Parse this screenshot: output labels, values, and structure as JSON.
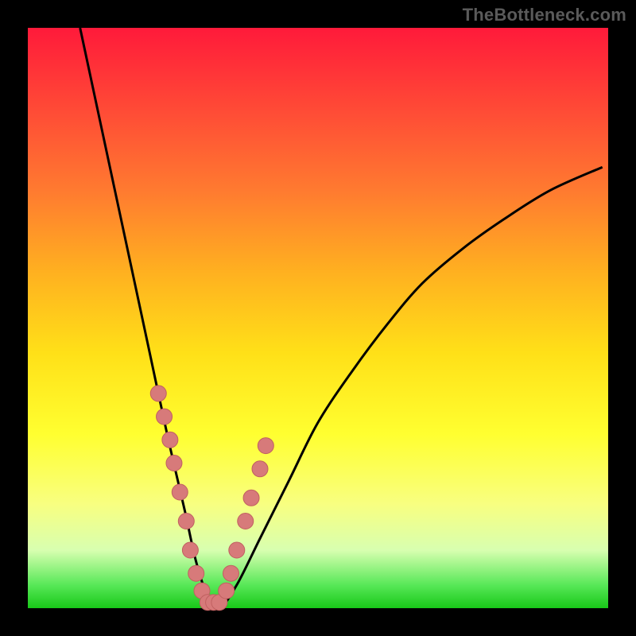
{
  "attribution": "TheBottleneck.com",
  "colors": {
    "frame": "#000000",
    "curve": "#000000",
    "marker_fill": "#d77a7a",
    "marker_stroke": "#c06060",
    "gradient_top": "#ff1a3a",
    "gradient_bottom": "#18c818"
  },
  "chart_data": {
    "type": "line",
    "title": "",
    "xlabel": "",
    "ylabel": "",
    "xlim": [
      0,
      100
    ],
    "ylim": [
      0,
      100
    ],
    "grid": false,
    "legend": false,
    "series": [
      {
        "name": "bottleneck-curve",
        "x": [
          9,
          12,
          15,
          18,
          21,
          24,
          27,
          29,
          31,
          33,
          36,
          40,
          45,
          50,
          56,
          62,
          68,
          75,
          82,
          90,
          99
        ],
        "y": [
          100,
          86,
          72,
          58,
          44,
          30,
          17,
          8,
          2,
          0,
          4,
          12,
          22,
          32,
          41,
          49,
          56,
          62,
          67,
          72,
          76
        ]
      }
    ],
    "markers": {
      "name": "highlighted-points",
      "x": [
        22.5,
        23.5,
        24.5,
        25.2,
        26.2,
        27.3,
        28.0,
        29.0,
        30.0,
        31.0,
        32.0,
        33.0,
        34.2,
        35.0,
        36.0,
        37.5,
        38.5,
        40.0,
        41.0
      ],
      "y": [
        37,
        33,
        29,
        25,
        20,
        15,
        10,
        6,
        3,
        1,
        1,
        1,
        3,
        6,
        10,
        15,
        19,
        24,
        28
      ]
    }
  }
}
